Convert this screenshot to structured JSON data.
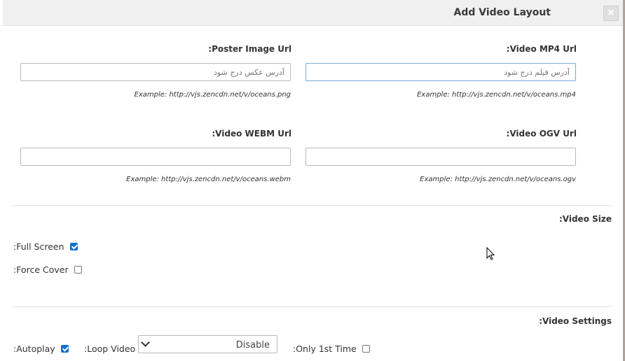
{
  "dialog": {
    "title": "Add Video Layout",
    "close_label": "×"
  },
  "fields": {
    "poster": {
      "label": "Poster Image Url:",
      "placeholder": "آدرس عکس درج شود",
      "example": "Example: http://vjs.zencdn.net/v/oceans.png"
    },
    "mp4": {
      "label": "Video MP4 Url:",
      "placeholder": "آدرس فیلم درج شود",
      "example": "Example: http://vjs.zencdn.net/v/oceans.mp4"
    },
    "webm": {
      "label": "Video WEBM Url:",
      "placeholder": "",
      "example": "Example: http://vjs.zencdn.net/v/oceans.webm"
    },
    "ogv": {
      "label": "Video OGV Url:",
      "placeholder": "",
      "example": "Example: http://vjs.zencdn.net/v/oceans.ogv"
    }
  },
  "video_size": {
    "title": "Video Size:",
    "full_screen": {
      "label": ":Full Screen",
      "checked": true
    },
    "force_cover": {
      "label": ":Force Cover",
      "checked": false
    }
  },
  "video_settings": {
    "title": "Video Settings:",
    "autoplay": {
      "label": ":Autoplay",
      "checked": true
    },
    "loop_video": {
      "label": ":Loop Video",
      "selected": "Disable"
    },
    "only_first_time": {
      "label": ":Only 1st Time",
      "checked": false
    }
  },
  "icons": {
    "close": "close-icon",
    "chevron": "chevron-down-icon",
    "cursor": "mouse-pointer-icon"
  }
}
